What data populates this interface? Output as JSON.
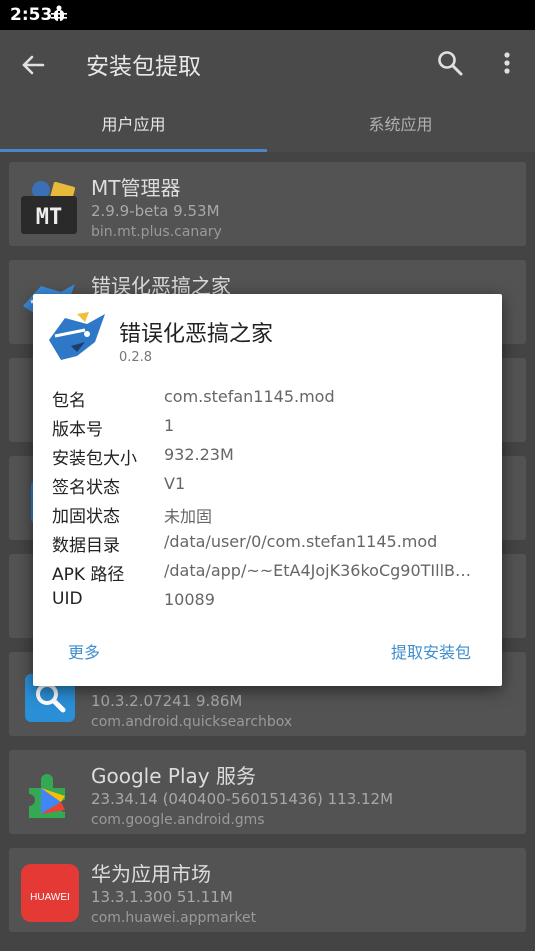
{
  "status_bar": {
    "time": "2:53",
    "notification_icon": "bug-icon"
  },
  "app_bar": {
    "title": "安装包提取",
    "back_icon": "arrow-back-icon",
    "search_icon": "search-icon",
    "more_icon": "more-vert-icon"
  },
  "tabs": [
    {
      "label": "用户应用",
      "selected": true
    },
    {
      "label": "系统应用",
      "selected": false
    }
  ],
  "accent": "#4a86c8",
  "apps": [
    {
      "name": "MT管理器",
      "meta": "2.9.9-beta   9.53M",
      "package": "bin.mt.plus.canary",
      "icon": "mt-manager-icon"
    },
    {
      "name": "错误化恶搞之家",
      "meta": "",
      "package": "",
      "icon": "app-mascot-icon"
    },
    {
      "name": "",
      "meta": "",
      "package": "",
      "icon": "green-app-icon"
    },
    {
      "name": "",
      "meta": "",
      "package": "",
      "icon": "blue-app-icon"
    },
    {
      "name": "",
      "meta": "",
      "package": "",
      "icon": "dark-app-icon"
    },
    {
      "name": "",
      "meta": "10.3.2.07241   9.86M",
      "package": "com.android.quicksearchbox",
      "icon": "quick-search-icon"
    },
    {
      "name": "Google Play 服务",
      "meta": "23.34.14 (040400-560151436)   113.12M",
      "package": "com.google.android.gms",
      "icon": "google-play-services-icon"
    },
    {
      "name": "华为应用市场",
      "meta": "13.3.1.300   51.11M",
      "package": "com.huawei.appmarket",
      "icon": "huawei-icon",
      "icon_text": "HUAWEI"
    }
  ],
  "dialog": {
    "title": "错误化恶搞之家",
    "version": "0.2.8",
    "rows": [
      {
        "label": "包名",
        "value": "com.stefan1145.mod"
      },
      {
        "label": "版本号",
        "value": "1"
      },
      {
        "label": "安装包大小",
        "value": "932.23M"
      },
      {
        "label": "签名状态",
        "value": "V1"
      },
      {
        "label": "加固状态",
        "value": "未加固"
      },
      {
        "label": "数据目录",
        "value": "/data/user/0/com.stefan1145.mod"
      },
      {
        "label": "APK 路径",
        "value": "/data/app/~~EtA4JojK36koCg90TIllB…"
      },
      {
        "label": "UID",
        "value": "10089"
      }
    ],
    "more_button": "更多",
    "extract_button": "提取安装包"
  }
}
